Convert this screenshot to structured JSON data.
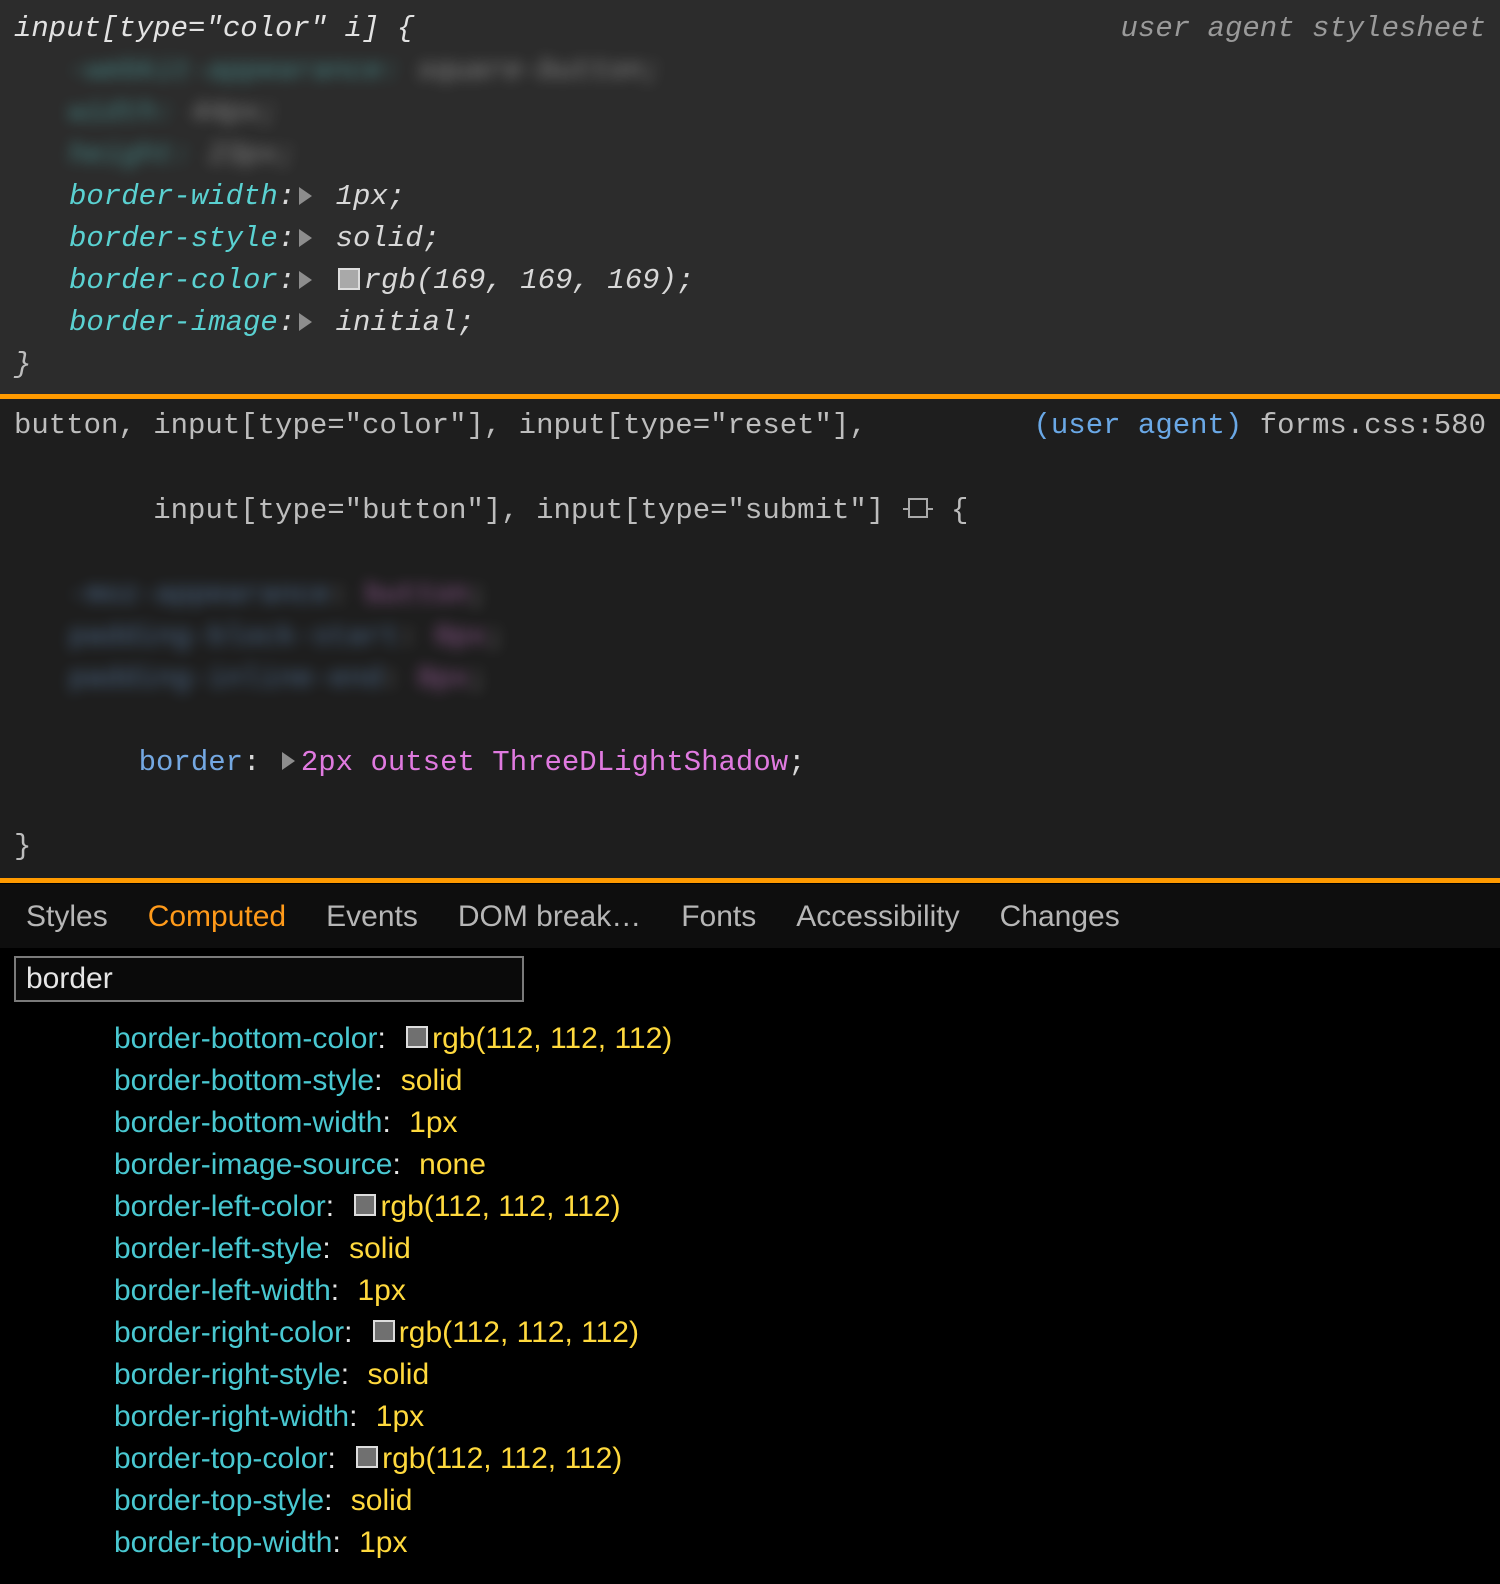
{
  "pane1": {
    "selector": "input[type=\"color\" i] {",
    "uas_label": "user agent stylesheet",
    "rules": [
      {
        "prop": "border-width",
        "value": "1px;"
      },
      {
        "prop": "border-style",
        "value": "solid;"
      },
      {
        "prop": "border-color",
        "value": "rgb(169, 169, 169);",
        "swatch": "#a9a9a9"
      },
      {
        "prop": "border-image",
        "value": "initial;"
      }
    ],
    "close": "}"
  },
  "pane2": {
    "selector_l1": "button, input[type=\"color\"], input[type=\"reset\"],",
    "selector_l2_pre": "input[type=\"button\"], input[type=\"submit\"] ",
    "selector_l2_post": " {",
    "source_ua": "(user agent)",
    "source_file": "forms.css:580",
    "rule": {
      "prop": "border",
      "value": "2px outset ThreeDLightShadow",
      "semi": ";"
    },
    "close": "}"
  },
  "tabs": [
    "Styles",
    "Computed",
    "Events",
    "DOM break…",
    "Fonts",
    "Accessibility",
    "Changes"
  ],
  "active_tab_index": 1,
  "filter_value": "border",
  "computed": [
    {
      "name": "border-bottom-color",
      "value": "rgb(112, 112, 112)",
      "swatch": true
    },
    {
      "name": "border-bottom-style",
      "value": "solid"
    },
    {
      "name": "border-bottom-width",
      "value": "1px"
    },
    {
      "name": "border-image-source",
      "value": "none"
    },
    {
      "name": "border-left-color",
      "value": "rgb(112, 112, 112)",
      "swatch": true
    },
    {
      "name": "border-left-style",
      "value": "solid"
    },
    {
      "name": "border-left-width",
      "value": "1px"
    },
    {
      "name": "border-right-color",
      "value": "rgb(112, 112, 112)",
      "swatch": true
    },
    {
      "name": "border-right-style",
      "value": "solid"
    },
    {
      "name": "border-right-width",
      "value": "1px"
    },
    {
      "name": "border-top-color",
      "value": "rgb(112, 112, 112)",
      "swatch": true
    },
    {
      "name": "border-top-style",
      "value": "solid"
    },
    {
      "name": "border-top-width",
      "value": "1px"
    }
  ]
}
